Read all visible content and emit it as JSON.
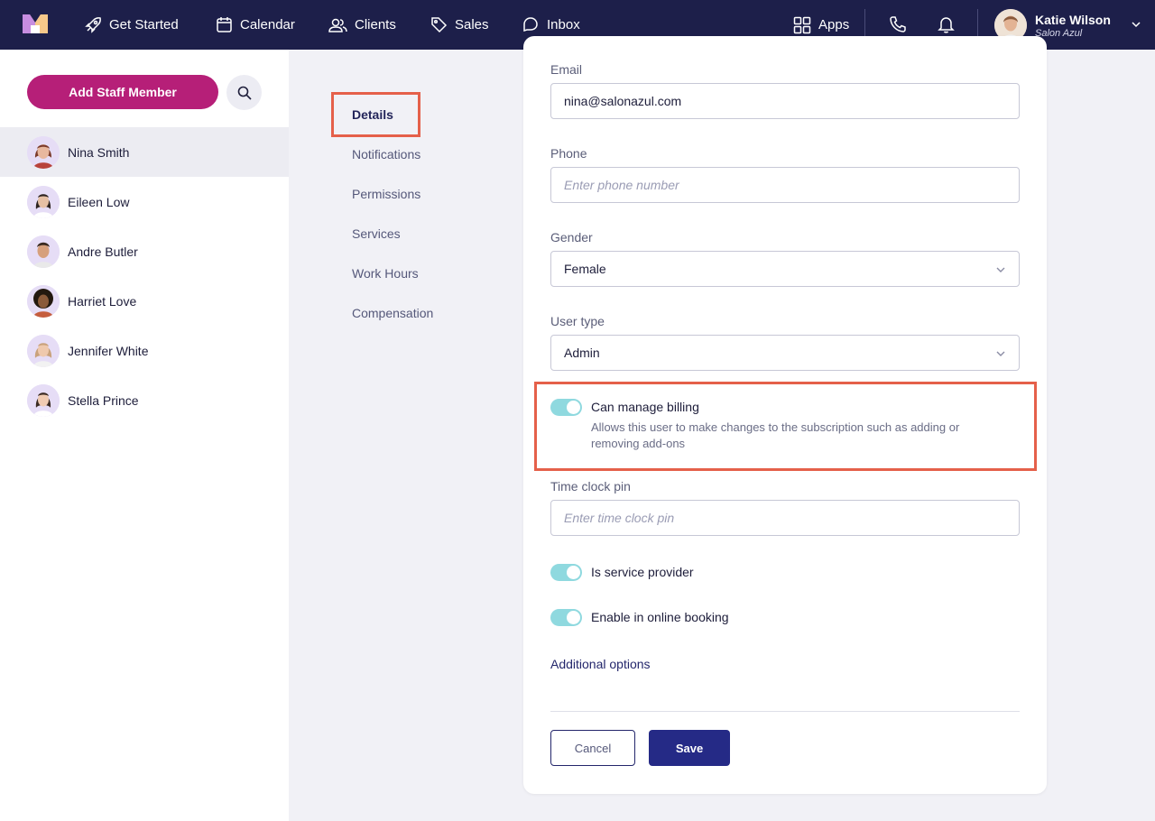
{
  "nav": {
    "items": [
      {
        "label": "Get Started",
        "icon": "rocket-icon"
      },
      {
        "label": "Calendar",
        "icon": "calendar-icon"
      },
      {
        "label": "Clients",
        "icon": "users-icon"
      },
      {
        "label": "Sales",
        "icon": "tag-icon"
      },
      {
        "label": "Inbox",
        "icon": "chat-icon"
      }
    ],
    "apps_label": "Apps",
    "user": {
      "name": "Katie Wilson",
      "org": "Salon Azul"
    }
  },
  "sidebar": {
    "add_button": "Add Staff Member",
    "staff": [
      {
        "name": "Nina Smith",
        "active": true
      },
      {
        "name": "Eileen Low"
      },
      {
        "name": "Andre Butler"
      },
      {
        "name": "Harriet Love"
      },
      {
        "name": "Jennifer White"
      },
      {
        "name": "Stella Prince"
      }
    ]
  },
  "subnav": {
    "items": [
      "Details",
      "Notifications",
      "Permissions",
      "Services",
      "Work Hours",
      "Compensation"
    ],
    "active": "Details"
  },
  "form": {
    "email": {
      "label": "Email",
      "value": "nina@salonazul.com"
    },
    "phone": {
      "label": "Phone",
      "placeholder": "Enter phone number"
    },
    "gender": {
      "label": "Gender",
      "value": "Female"
    },
    "user_type": {
      "label": "User type",
      "value": "Admin"
    },
    "billing": {
      "label": "Can manage billing",
      "description": "Allows this user to make changes to the subscription such as adding or removing add-ons",
      "enabled": true
    },
    "time_clock": {
      "label": "Time clock pin",
      "placeholder": "Enter time clock pin"
    },
    "service_provider": {
      "label": "Is service provider",
      "enabled": true
    },
    "online_booking": {
      "label": "Enable in online booking",
      "enabled": true
    },
    "additional_options": "Additional options",
    "cancel": "Cancel",
    "save": "Save"
  },
  "colors": {
    "nav_bg": "#1d1f4a",
    "brand_magenta": "#b61f78",
    "toggle_on": "#8fd9df",
    "primary_button": "#252a86",
    "highlight": "#e5604a"
  }
}
